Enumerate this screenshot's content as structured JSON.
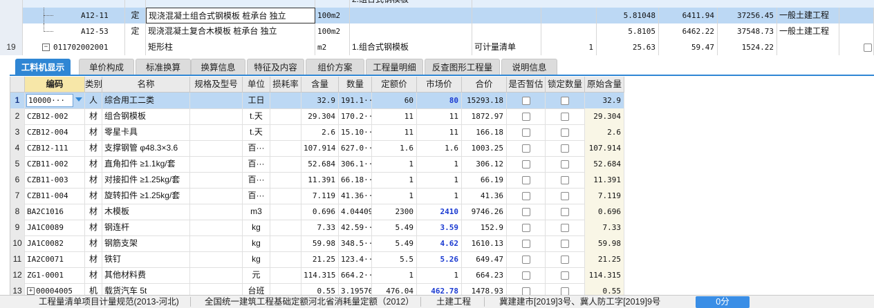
{
  "top_grid": {
    "partial_row": {
      "unit": "",
      "feature": "2.组合式钢模板"
    },
    "rows": [
      {
        "row_num": "",
        "code": "A12-11",
        "kind": "定",
        "name": "现浇混凝土组合式钢模板 桩承台 独立",
        "unit": "100m2",
        "feature": "",
        "type": "",
        "qty": "",
        "price": "5.81048",
        "unit_price": "6411.94",
        "total": "37256.45",
        "specialty": "一般土建工程",
        "selected": true
      },
      {
        "row_num": "",
        "code": "A12-53",
        "kind": "定",
        "name": "现浇混凝土复合木模板 桩承台 独立",
        "unit": "100m2",
        "feature": "",
        "type": "",
        "qty": "",
        "price": "5.8105",
        "unit_price": "6462.22",
        "total": "37548.73",
        "specialty": "一般土建工程",
        "selected": false
      },
      {
        "row_num": "19",
        "code": "011702002001",
        "kind": "",
        "name": "矩形柱",
        "unit": "m2",
        "feature": "1.组合式钢模板",
        "type": "可计量清单",
        "qty": "1",
        "price": "25.63",
        "unit_price": "59.47",
        "total": "1524.22",
        "specialty": "",
        "selected": false
      }
    ]
  },
  "tabs": [
    {
      "label": "工料机显示",
      "active": true
    },
    {
      "label": "单价构成",
      "active": false
    },
    {
      "label": "标准换算",
      "active": false
    },
    {
      "label": "换算信息",
      "active": false
    },
    {
      "label": "特征及内容",
      "active": false
    },
    {
      "label": "组价方案",
      "active": false
    },
    {
      "label": "工程量明细",
      "active": false
    },
    {
      "label": "反查图形工程量",
      "active": false
    },
    {
      "label": "说明信息",
      "active": false
    }
  ],
  "detail": {
    "headers": [
      "编码",
      "类别",
      "名称",
      "规格及型号",
      "单位",
      "损耗率",
      "含量",
      "数量",
      "定额价",
      "市场价",
      "合价",
      "是否暂估",
      "锁定数量",
      "原始含量"
    ],
    "rows": [
      {
        "num": "1",
        "code": "10000···",
        "cat": "人",
        "name": "综合用工二类",
        "spec": "",
        "unit": "工日",
        "loss": "",
        "content": "32.9",
        "qty": "191.1···",
        "quota": "60",
        "market": "80",
        "market_blue": true,
        "total": "15293.18",
        "est": false,
        "lock": true,
        "orig": "32.9",
        "selected": true
      },
      {
        "num": "2",
        "code": "CZB12-002",
        "cat": "材",
        "name": "组合钢模板",
        "spec": "",
        "unit": "t.天",
        "loss": "",
        "content": "29.304",
        "qty": "170.2···",
        "quota": "11",
        "market": "11",
        "market_blue": false,
        "total": "1872.97",
        "est": true,
        "lock": true,
        "orig": "29.304",
        "selected": false
      },
      {
        "num": "3",
        "code": "CZB12-004",
        "cat": "材",
        "name": "零星卡具",
        "spec": "",
        "unit": "t.天",
        "loss": "",
        "content": "2.6",
        "qty": "15.10···",
        "quota": "11",
        "market": "11",
        "market_blue": false,
        "total": "166.18",
        "est": true,
        "lock": true,
        "orig": "2.6",
        "selected": false
      },
      {
        "num": "4",
        "code": "CZB12-111",
        "cat": "材",
        "name": "支撑钢管 φ48.3×3.6",
        "spec": "",
        "unit": "百···",
        "loss": "",
        "content": "107.914",
        "qty": "627.0···",
        "quota": "1.6",
        "market": "1.6",
        "market_blue": false,
        "total": "1003.25",
        "est": true,
        "lock": true,
        "orig": "107.914",
        "selected": false
      },
      {
        "num": "5",
        "code": "CZB11-002",
        "cat": "材",
        "name": "直角扣件 ≥1.1kg/套",
        "spec": "",
        "unit": "百···",
        "loss": "",
        "content": "52.684",
        "qty": "306.1···",
        "quota": "1",
        "market": "1",
        "market_blue": false,
        "total": "306.12",
        "est": true,
        "lock": true,
        "orig": "52.684",
        "selected": false
      },
      {
        "num": "6",
        "code": "CZB11-003",
        "cat": "材",
        "name": "对接扣件 ≥1.25kg/套",
        "spec": "",
        "unit": "百···",
        "loss": "",
        "content": "11.391",
        "qty": "66.18···",
        "quota": "1",
        "market": "1",
        "market_blue": false,
        "total": "66.19",
        "est": true,
        "lock": true,
        "orig": "11.391",
        "selected": false
      },
      {
        "num": "7",
        "code": "CZB11-004",
        "cat": "材",
        "name": "旋转扣件 ≥1.25kg/套",
        "spec": "",
        "unit": "百···",
        "loss": "",
        "content": "7.119",
        "qty": "41.36···",
        "quota": "1",
        "market": "1",
        "market_blue": false,
        "total": "41.36",
        "est": true,
        "lock": true,
        "orig": "7.119",
        "selected": false
      },
      {
        "num": "8",
        "code": "BA2C1016",
        "cat": "材",
        "name": "木模板",
        "spec": "",
        "unit": "m3",
        "loss": "",
        "content": "0.696",
        "qty": "4.04409",
        "quota": "2300",
        "market": "2410",
        "market_blue": true,
        "total": "9746.26",
        "est": true,
        "lock": true,
        "orig": "0.696",
        "selected": false
      },
      {
        "num": "9",
        "code": "JA1C0089",
        "cat": "材",
        "name": "钢连杆",
        "spec": "",
        "unit": "kg",
        "loss": "",
        "content": "7.33",
        "qty": "42.59···",
        "quota": "5.49",
        "market": "3.59",
        "market_blue": true,
        "total": "152.9",
        "est": true,
        "lock": true,
        "orig": "7.33",
        "selected": false
      },
      {
        "num": "10",
        "code": "JA1C0082",
        "cat": "材",
        "name": "钢筋支架",
        "spec": "",
        "unit": "kg",
        "loss": "",
        "content": "59.98",
        "qty": "348.5···",
        "quota": "5.49",
        "market": "4.62",
        "market_blue": true,
        "total": "1610.13",
        "est": true,
        "lock": true,
        "orig": "59.98",
        "selected": false
      },
      {
        "num": "11",
        "code": "IA2C0071",
        "cat": "材",
        "name": "铁钉",
        "spec": "",
        "unit": "kg",
        "loss": "",
        "content": "21.25",
        "qty": "123.4···",
        "quota": "5.5",
        "market": "5.26",
        "market_blue": true,
        "total": "649.47",
        "est": true,
        "lock": true,
        "orig": "21.25",
        "selected": false
      },
      {
        "num": "12",
        "code": "ZG1-0001",
        "cat": "材",
        "name": "其他材料费",
        "spec": "",
        "unit": "元",
        "loss": "",
        "content": "114.315",
        "qty": "664.2···",
        "quota": "1",
        "market": "1",
        "market_blue": false,
        "total": "664.23",
        "est": true,
        "lock": true,
        "orig": "114.315",
        "selected": false
      },
      {
        "num": "13",
        "code": "00004005",
        "cat": "机",
        "name": "载货汽车 5t",
        "spec": "",
        "unit": "台班",
        "loss": "",
        "content": "0.55",
        "qty": "3.19576",
        "quota": "476.04",
        "market": "462.78",
        "market_blue": true,
        "total": "1478.93",
        "est": true,
        "lock": true,
        "orig": "0.55",
        "selected": false
      }
    ]
  },
  "status": {
    "items": [
      "工程量清单项目计量规范(2013-河北)",
      "全国统一建筑工程基础定额河北省消耗量定额（2012）",
      "土建工程",
      "冀建建市[2019]3号、冀人防工字[2019]9号"
    ],
    "score": "0分"
  },
  "colors": {
    "accent": "#2f86d4",
    "selected_row": "#bcd8f4",
    "market_changed": "#1a3ad1"
  }
}
